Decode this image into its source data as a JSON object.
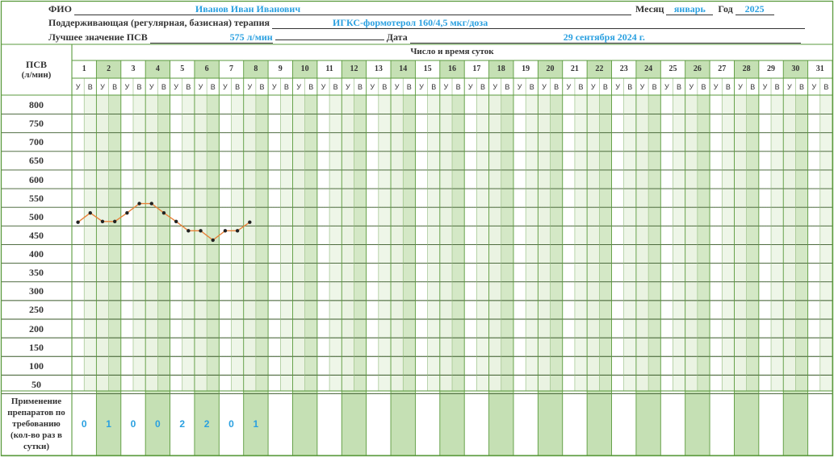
{
  "header": {
    "fio_label": "ФИО",
    "fio_value": "Иванов Иван Иванович",
    "month_label": "Месяц",
    "month_value": "январь",
    "year_label": "Год",
    "year_value": "2025",
    "therapy_label": "Поддерживающая (регулярная, базисная) терапия",
    "therapy_value": "ИГКС-формотерол 160/4,5 мкг/доза",
    "best_label": "Лучшее значение ПСВ",
    "best_value": "575 л/мин",
    "date_label": "Дата",
    "date_value": "29 сентября 2024 г."
  },
  "table": {
    "psv_label_line1": "ПСВ",
    "psv_label_line2": "(л/мин)",
    "days_title": "Число и время суток",
    "morning_abbr": "У",
    "evening_abbr": "В",
    "req_label": [
      "Применение",
      "препаратов по",
      "требованию",
      "(кол-во раз в",
      "сутки)"
    ],
    "days": [
      "1",
      "2",
      "3",
      "4",
      "5",
      "6",
      "7",
      "8",
      "9",
      "10",
      "11",
      "12",
      "13",
      "14",
      "15",
      "16",
      "17",
      "18",
      "19",
      "20",
      "21",
      "22",
      "23",
      "24",
      "25",
      "26",
      "27",
      "28",
      "29",
      "30",
      "31"
    ],
    "y_ticks": [
      "800",
      "750",
      "700",
      "650",
      "600",
      "550",
      "500",
      "450",
      "400",
      "350",
      "300",
      "250",
      "200",
      "150",
      "100",
      "50"
    ],
    "on_demand_uses": [
      "0",
      "1",
      "0",
      "0",
      "2",
      "2",
      "0",
      "1"
    ]
  },
  "colors": {
    "green_dark": "#5a9a3c",
    "green_fill": "#c5e0b4",
    "line": "#e8823a",
    "values": "#2aa0e0"
  },
  "chart_data": {
    "type": "line",
    "title": "",
    "xlabel": "Число и время суток",
    "ylabel": "ПСВ (л/мин)",
    "ylim": [
      25,
      825
    ],
    "x": [
      "1 У",
      "1 В",
      "2 У",
      "2 В",
      "3 У",
      "3 В",
      "4 У",
      "4 В",
      "5 У",
      "5 В",
      "6 У",
      "6 В",
      "7 У",
      "7 В",
      "8 У"
    ],
    "series": [
      {
        "values": [
          485,
          510,
          487,
          487,
          510,
          535,
          535,
          510,
          487,
          462,
          462,
          437,
          462,
          462,
          485
        ]
      }
    ]
  }
}
